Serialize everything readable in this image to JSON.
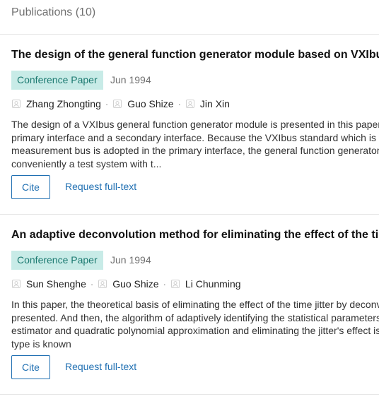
{
  "header": {
    "title": "Publications (10)"
  },
  "publications": [
    {
      "title": "The design of the general function generator module based on VXIbus",
      "type": "Conference Paper",
      "date": "Jun 1994",
      "authors": [
        "Zhang Zhongting",
        "Guo Shize",
        "Jin Xin"
      ],
      "separator": "·",
      "abstract_lines": [
        "The design of a VXIbus general function generator module is presented in this paper",
        "primary interface and a secondary interface. Because the VXIbus standard which is",
        "measurement bus is adopted in the primary interface, the general function generator",
        "conveniently a test system with t..."
      ],
      "cite_label": "Cite",
      "fulltext_label": "Request full-text"
    },
    {
      "title": "An adaptive deconvolution method for eliminating the effect of the time",
      "type": "Conference Paper",
      "date": "Jun 1994",
      "authors": [
        "Sun Shenghe",
        "Guo Shize",
        "Li Chunming"
      ],
      "separator": "·",
      "abstract_lines": [
        "In this paper, the theoretical basis of eliminating the effect of the time jitter by deconv",
        "presented. And then, the algorithm of adaptively identifying the statistical parameters",
        "estimator and quadratic polynomial approximation and eliminating the jitter's effect is",
        "type is known"
      ],
      "cite_label": "Cite",
      "fulltext_label": "Request full-text"
    }
  ],
  "colors": {
    "badge_bg": "#c8ebe7",
    "badge_text": "#1c7a71",
    "link": "#1f6fb2",
    "divider": "#e6e6e6"
  },
  "icons": {
    "author": "author-avatar-icon"
  }
}
